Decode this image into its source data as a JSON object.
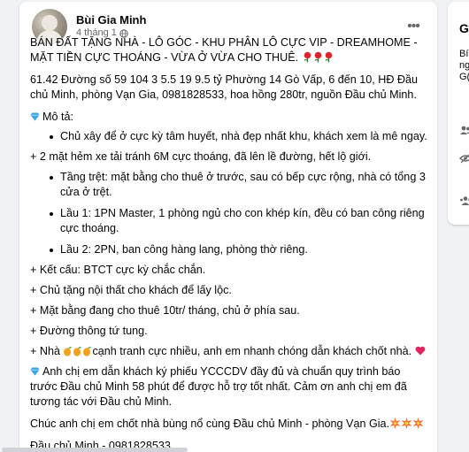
{
  "post": {
    "author": "Bùi Gia Minh",
    "time": "4 tháng 1",
    "more_label": "•••",
    "title": "BÁN ĐẤT TẶNG NHÀ - LÔ GÓC - KHU PHÂN LÔ CỰC VIP - DREAMHOME - MẶT TIỀN CỰC THOÁNG - VỪA Ở VỪA CHO THUÊ.",
    "info": "61.42 Đường số 59 104 3 5.5 19 9.5 tỷ Phường 14 Gò Vấp, 6 đến 10, HĐ Đầu chủ Minh, phòng Vạn Gia, 0981828533, hoa hồng 280tr, nguồn Đầu chủ Minh.",
    "desc_heading": "Mô tả:",
    "bullet_1": "Chủ xây để ở cực kỳ tâm huyết, nhà đẹp nhất khu, khách xem là mê ngay.",
    "line_2_mat_hem": "+ 2 mặt hẻm xe tải tránh 6M cực thoáng, đã lên lề đường, hết lộ giới.",
    "bullet_tang_tret": "Tầng trệt: mặt bằng cho thuê ở trước, sau có bếp cực rộng, nhà có tổng 3 cửa ở trệt.",
    "bullet_lau_1": "Lầu 1: 1PN Master, 1 phòng ngủ cho con khép kín, đều có ban công riêng cực thoáng.",
    "bullet_lau_2": "Lầu 2: 2PN, ban công hàng lang, phòng thờ riêng.",
    "line_ket_cau": "+ Kết cấu: BTCT cực kỳ chắc chắn.",
    "line_noi_that": "+ Chủ tặng nội thất cho khách để lấy lộc.",
    "line_mat_bang": "+ Mặt bằng đang cho thuê 10tr/ tháng, chủ ở phía sau.",
    "line_duong": "+ Đường thông tứ tung.",
    "line_nha_prefix": "+ Nhà ",
    "line_nha_suffix": "cạnh tranh cực nhiều, anh em nhanh chóng dẫn khách chốt nhà.",
    "line_dan_khach": "Anh chị em dẫn khách ký phiếu YCCCDV đầy đủ và chuẩn quy trình báo trước Đầu chủ Minh 58 phút để được hỗ trợ tốt nhất. Cảm ơn anh chị em đã tương tác với Đầu chủ Minh.",
    "line_chuc": "Chúc anh chị em chốt nhà bùng nổ cùng Đầu chủ Minh - phòng Vạn Gia.",
    "line_sign": "Đầu chủ Minh - 0981828533."
  },
  "side_panel": {
    "title": "G",
    "line1": "Bí",
    "line2": "ng",
    "line3": "G("
  },
  "colors": {
    "page_bg": "#f0f2f5",
    "card_bg": "#ffffff",
    "meta_text": "#65676b",
    "diamond": "#3ba7e8",
    "heart": "#e0245e",
    "rose": "#d9262c",
    "mango": "#f4a21b"
  },
  "icons": [
    "globe-icon",
    "more-icon",
    "rose-icon",
    "diamond-icon",
    "mango-icon",
    "heart-icon",
    "burst-icon"
  ]
}
